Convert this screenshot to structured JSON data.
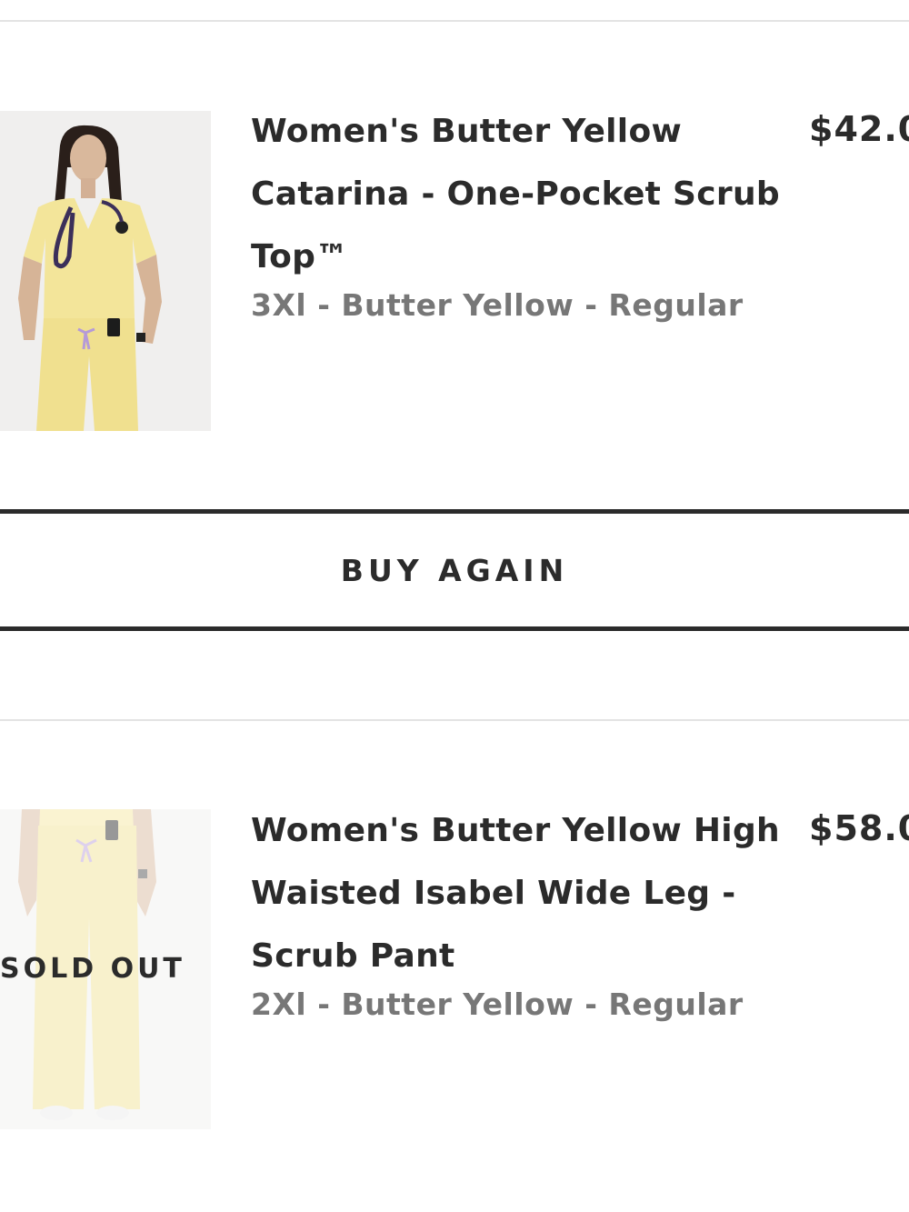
{
  "items": [
    {
      "title_lines": [
        "Women's Butter Yellow",
        "Catarina - One-Pocket Scrub",
        "Top™"
      ],
      "variant": "3Xl - Butter Yellow - Regular",
      "price": "$42.0"
    },
    {
      "title_lines": [
        "Women's Butter Yellow High",
        "Waisted Isabel Wide Leg -",
        "Scrub Pant"
      ],
      "variant": "2Xl - Butter Yellow - Regular",
      "price": "$58.0",
      "sold_out_label": "SOLD OUT"
    }
  ],
  "buy_again_label": "BUY AGAIN",
  "colors": {
    "scrub_yellow": "#f3e59a",
    "text_dark": "#2b2b2b",
    "text_muted": "#777777"
  }
}
